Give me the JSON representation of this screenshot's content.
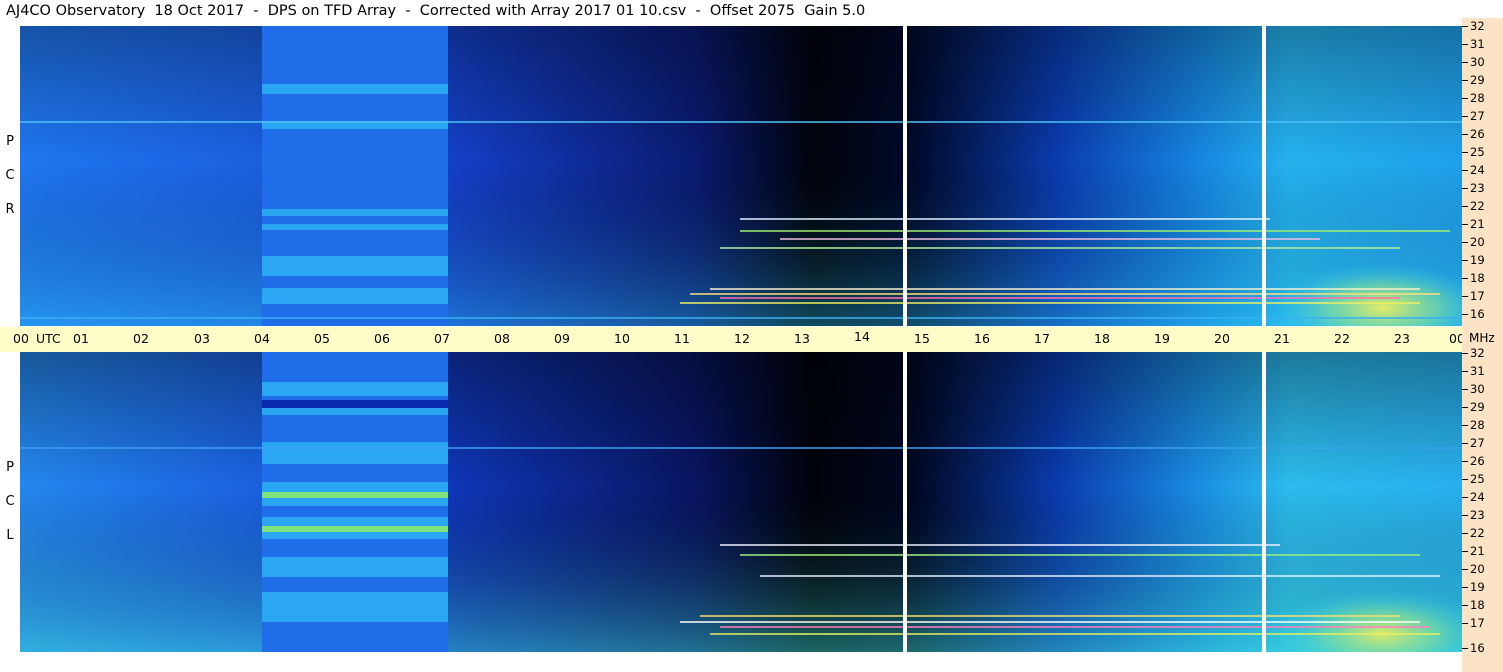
{
  "header": {
    "title": "AJ4CO Observatory  18 Oct 2017  -  DPS on TFD Array  -  Corrected with Array 2017 01 10.csv  -  Offset 2075  Gain 5.0"
  },
  "panels": [
    {
      "id": "rcp",
      "letters": [
        "R",
        "C",
        "P"
      ]
    },
    {
      "id": "lcp",
      "letters": [
        "L",
        "C",
        "P"
      ]
    }
  ],
  "frequency_axis": {
    "unit": "MHz",
    "labels": [
      "32",
      "31",
      "30",
      "29",
      "28",
      "27",
      "26",
      "25",
      "24",
      "23",
      "22",
      "21",
      "20",
      "19",
      "18",
      "17",
      "16"
    ]
  },
  "time_axis": {
    "unit": "UTC",
    "labels": [
      "00",
      "01",
      "02",
      "03",
      "04",
      "05",
      "06",
      "07",
      "08",
      "09",
      "10",
      "11",
      "12",
      "13",
      "14",
      "15",
      "16",
      "17",
      "18",
      "19",
      "20",
      "21",
      "22",
      "23",
      "00"
    ]
  },
  "colors": {
    "deep_blue": "#0a2fb8",
    "mid_blue": "#1e6cf0",
    "cyan": "#2bc4ee",
    "dark": "#000510",
    "yellow": "#e8f04a",
    "time_axis_bg": "#fffec8",
    "freq_axis_bg": "#fde3c5"
  }
}
